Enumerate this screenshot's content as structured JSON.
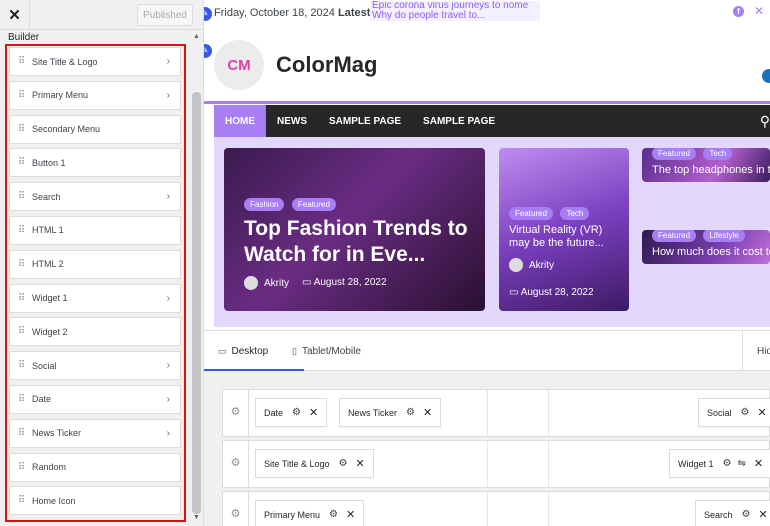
{
  "panel": {
    "close_label": "✕",
    "publish_label": "Published",
    "section_title": "Builder",
    "components": [
      {
        "label": "Site Title & Logo",
        "has_arrow": true
      },
      {
        "label": "Primary Menu",
        "has_arrow": true
      },
      {
        "label": "Secondary Menu",
        "has_arrow": false
      },
      {
        "label": "Button 1",
        "has_arrow": false
      },
      {
        "label": "Search",
        "has_arrow": true
      },
      {
        "label": "HTML 1",
        "has_arrow": false
      },
      {
        "label": "HTML 2",
        "has_arrow": false
      },
      {
        "label": "Widget 1",
        "has_arrow": true
      },
      {
        "label": "Widget 2",
        "has_arrow": false
      },
      {
        "label": "Social",
        "has_arrow": true
      },
      {
        "label": "Date",
        "has_arrow": true
      },
      {
        "label": "News Ticker",
        "has_arrow": true
      },
      {
        "label": "Random",
        "has_arrow": false
      },
      {
        "label": "Home Icon",
        "has_arrow": false
      }
    ]
  },
  "preview": {
    "date": "Friday, October 18, 2024",
    "latest_label": "Latest:",
    "ticker_line1": "Epic corona virus journeys to nome",
    "ticker_line2": "Why do people travel to...",
    "site_title": "ColorMag",
    "logo_text": "CM",
    "nav": [
      {
        "label": "HOME",
        "active": true
      },
      {
        "label": "NEWS",
        "active": false
      },
      {
        "label": "SAMPLE PAGE",
        "active": false
      },
      {
        "label": "SAMPLE PAGE",
        "active": false
      }
    ],
    "cards": {
      "big": {
        "tags": [
          "Fashion",
          "Featured"
        ],
        "headline": "Top Fashion Trends to Watch for in Eve...",
        "author": "Akrity",
        "date": "August 28, 2022"
      },
      "mid": {
        "tags": [
          "Featured",
          "Tech"
        ],
        "headline": "Virtual Reality (VR) may be the future...",
        "author": "Akrity",
        "date": "August 28, 2022"
      },
      "small1": {
        "tags": [
          "Featured",
          "Tech"
        ],
        "headline": "The top headphones in the market right..."
      },
      "small2": {
        "tags": [
          "Featured",
          "Lifestyle"
        ],
        "headline": "How much does it cost to get..."
      }
    },
    "accent_color": "#a87ef5"
  },
  "builder": {
    "tabs": [
      {
        "label": "Desktop",
        "icon": "desktop-icon"
      },
      {
        "label": "Tablet/Mobile",
        "icon": "tablet-icon"
      }
    ],
    "hide_label": "Hide",
    "row1": {
      "left": [
        "Date",
        "News Ticker"
      ],
      "right": [
        "Social"
      ]
    },
    "row2": {
      "left": [
        "Site Title & Logo"
      ],
      "right": [
        "Widget 1"
      ]
    },
    "row3": {
      "left": [
        "Primary Menu"
      ],
      "right": [
        "Search"
      ]
    }
  }
}
